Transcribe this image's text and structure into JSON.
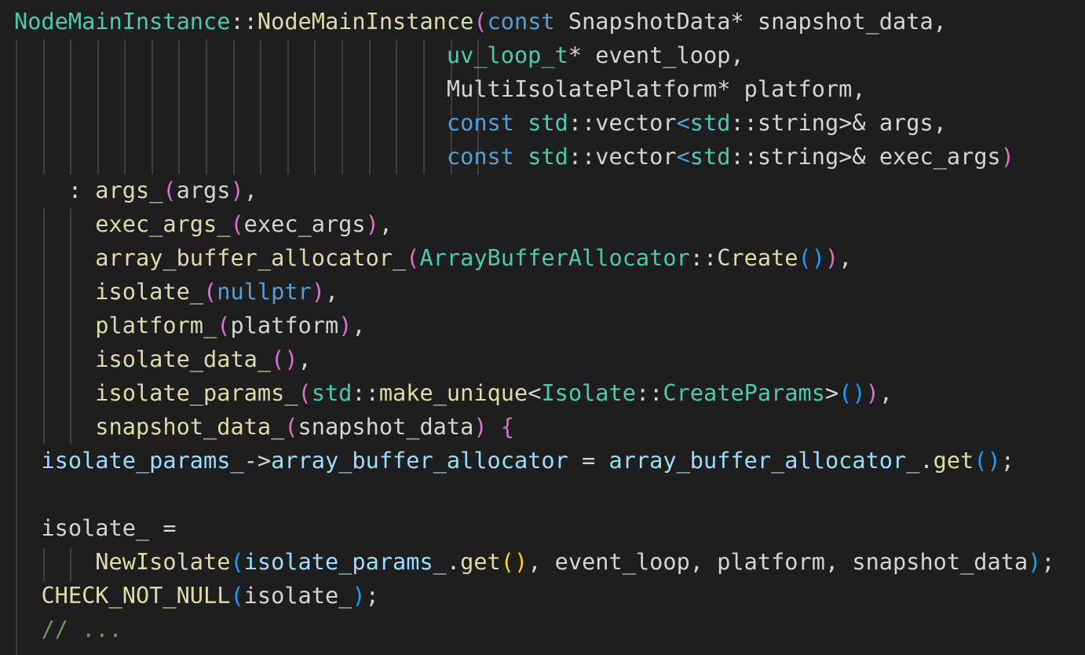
{
  "colors": {
    "background": "#1e1e1e",
    "function": "#dcdcaa",
    "type": "#4ec9b0",
    "keyword": "#569cd6",
    "variable": "#9cdcfe",
    "plain": "#d4d4d4",
    "comment": "#6a9955",
    "bracket_level_1": "#ffd700",
    "bracket_level_2": "#da70d6",
    "bracket_level_3": "#179fff",
    "indent_guide": "#3e3e3e"
  },
  "code": {
    "lines": [
      [
        [
          "NodeMainInstance",
          "type"
        ],
        [
          "::",
          "plain"
        ],
        [
          "NodeMainInstance",
          "fn"
        ],
        [
          "(",
          "br2"
        ],
        [
          "const",
          "kw"
        ],
        [
          " SnapshotData",
          "plain"
        ],
        [
          "*",
          "plain"
        ],
        [
          " snapshot_data,",
          "plain"
        ]
      ],
      [
        [
          "                                ",
          "plain"
        ],
        [
          "uv_loop_t",
          "type"
        ],
        [
          "*",
          "plain"
        ],
        [
          " event_loop,",
          "plain"
        ]
      ],
      [
        [
          "                                ",
          "plain"
        ],
        [
          "MultiIsolatePlatform",
          "plain"
        ],
        [
          "*",
          "plain"
        ],
        [
          " platform,",
          "plain"
        ]
      ],
      [
        [
          "                                ",
          "plain"
        ],
        [
          "const",
          "kw"
        ],
        [
          " ",
          "plain"
        ],
        [
          "std",
          "type"
        ],
        [
          "::",
          "plain"
        ],
        [
          "vector",
          "plain"
        ],
        [
          "<",
          "kw"
        ],
        [
          "std",
          "type"
        ],
        [
          "::",
          "plain"
        ],
        [
          "string",
          "plain"
        ],
        [
          ">&",
          "plain"
        ],
        [
          " args,",
          "plain"
        ]
      ],
      [
        [
          "                                ",
          "plain"
        ],
        [
          "const",
          "kw"
        ],
        [
          " ",
          "plain"
        ],
        [
          "std",
          "type"
        ],
        [
          "::",
          "plain"
        ],
        [
          "vector",
          "plain"
        ],
        [
          "<",
          "kw"
        ],
        [
          "std",
          "type"
        ],
        [
          "::",
          "plain"
        ],
        [
          "string",
          "plain"
        ],
        [
          ">&",
          "plain"
        ],
        [
          " exec_args",
          "plain"
        ],
        [
          ")",
          "br2"
        ]
      ],
      [
        [
          "    : ",
          "plain"
        ],
        [
          "args_",
          "fn"
        ],
        [
          "(",
          "br2"
        ],
        [
          "args",
          "plain"
        ],
        [
          ")",
          "br2"
        ],
        [
          ",",
          "plain"
        ]
      ],
      [
        [
          "      ",
          "plain"
        ],
        [
          "exec_args_",
          "fn"
        ],
        [
          "(",
          "br2"
        ],
        [
          "exec_args",
          "plain"
        ],
        [
          ")",
          "br2"
        ],
        [
          ",",
          "plain"
        ]
      ],
      [
        [
          "      ",
          "plain"
        ],
        [
          "array_buffer_allocator_",
          "fn"
        ],
        [
          "(",
          "br2"
        ],
        [
          "ArrayBufferAllocator",
          "type"
        ],
        [
          "::",
          "plain"
        ],
        [
          "Create",
          "fn"
        ],
        [
          "(",
          "br3"
        ],
        [
          ")",
          "br3"
        ],
        [
          ")",
          "br2"
        ],
        [
          ",",
          "plain"
        ]
      ],
      [
        [
          "      ",
          "plain"
        ],
        [
          "isolate_",
          "fn"
        ],
        [
          "(",
          "br2"
        ],
        [
          "nullptr",
          "kw"
        ],
        [
          ")",
          "br2"
        ],
        [
          ",",
          "plain"
        ]
      ],
      [
        [
          "      ",
          "plain"
        ],
        [
          "platform_",
          "fn"
        ],
        [
          "(",
          "br2"
        ],
        [
          "platform",
          "plain"
        ],
        [
          ")",
          "br2"
        ],
        [
          ",",
          "plain"
        ]
      ],
      [
        [
          "      ",
          "plain"
        ],
        [
          "isolate_data_",
          "fn"
        ],
        [
          "(",
          "br2"
        ],
        [
          ")",
          "br2"
        ],
        [
          ",",
          "plain"
        ]
      ],
      [
        [
          "      ",
          "plain"
        ],
        [
          "isolate_params_",
          "fn"
        ],
        [
          "(",
          "br2"
        ],
        [
          "std",
          "type"
        ],
        [
          "::",
          "plain"
        ],
        [
          "make_unique",
          "fn"
        ],
        [
          "<",
          "plain"
        ],
        [
          "Isolate",
          "type"
        ],
        [
          "::",
          "plain"
        ],
        [
          "CreateParams",
          "type"
        ],
        [
          ">",
          "plain"
        ],
        [
          "(",
          "br3"
        ],
        [
          ")",
          "br3"
        ],
        [
          ")",
          "br2"
        ],
        [
          ",",
          "plain"
        ]
      ],
      [
        [
          "      ",
          "plain"
        ],
        [
          "snapshot_data_",
          "fn"
        ],
        [
          "(",
          "br2"
        ],
        [
          "snapshot_data",
          "plain"
        ],
        [
          ")",
          "br2"
        ],
        [
          " ",
          "plain"
        ],
        [
          "{",
          "br2"
        ]
      ],
      [
        [
          "  ",
          "plain"
        ],
        [
          "isolate_params_",
          "var"
        ],
        [
          "->",
          "plain"
        ],
        [
          "array_buffer_allocator",
          "var"
        ],
        [
          " = ",
          "plain"
        ],
        [
          "array_buffer_allocator_",
          "var"
        ],
        [
          ".",
          "plain"
        ],
        [
          "get",
          "fn"
        ],
        [
          "(",
          "br3"
        ],
        [
          ")",
          "br3"
        ],
        [
          ";",
          "plain"
        ]
      ],
      [
        [
          "",
          "plain"
        ]
      ],
      [
        [
          "  isolate_ =",
          "plain"
        ]
      ],
      [
        [
          "      ",
          "plain"
        ],
        [
          "NewIsolate",
          "fn"
        ],
        [
          "(",
          "br3"
        ],
        [
          "isolate_params_",
          "var"
        ],
        [
          ".",
          "plain"
        ],
        [
          "get",
          "fn"
        ],
        [
          "(",
          "br1"
        ],
        [
          ")",
          "br1"
        ],
        [
          ", event_loop, platform, snapshot_data",
          "plain"
        ],
        [
          ")",
          "br3"
        ],
        [
          ";",
          "plain"
        ]
      ],
      [
        [
          "  ",
          "plain"
        ],
        [
          "CHECK_NOT_NULL",
          "fn"
        ],
        [
          "(",
          "br3"
        ],
        [
          "isolate_",
          "plain"
        ],
        [
          ")",
          "br3"
        ],
        [
          ";",
          "plain"
        ]
      ],
      [
        [
          "  ",
          "plain"
        ],
        [
          "// ...",
          "comment"
        ]
      ]
    ]
  }
}
